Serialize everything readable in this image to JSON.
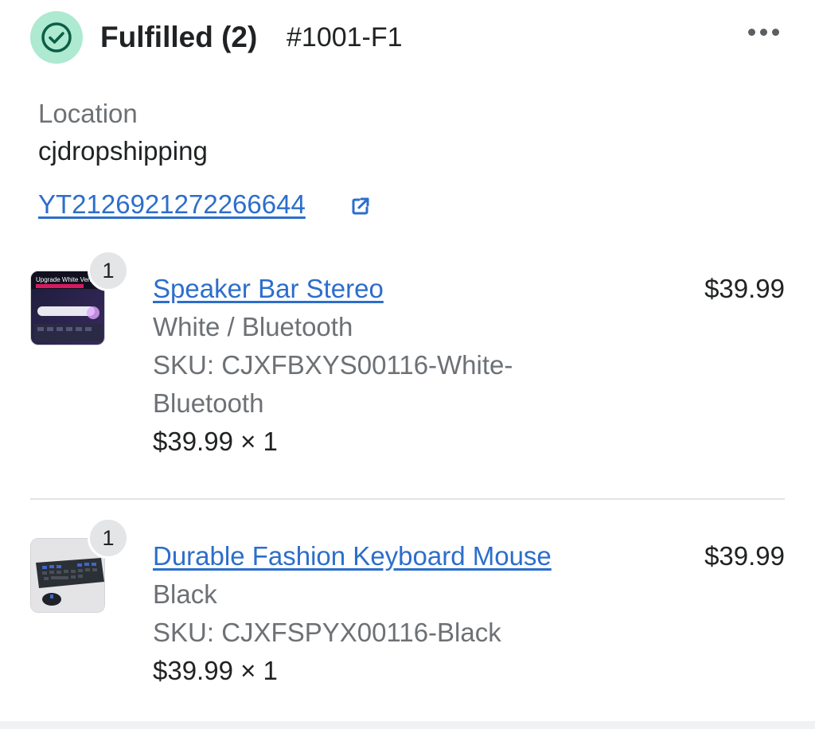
{
  "header": {
    "title": "Fulfilled (2)",
    "order_number": "#1001-F1",
    "status_icon": "check-circle-icon",
    "more_icon": "more-horizontal-icon",
    "status_color": "#aee9d1"
  },
  "location": {
    "label": "Location",
    "value": "cjdropshipping"
  },
  "tracking": {
    "number": "YT2126921272266644",
    "icon": "external-link-icon"
  },
  "items": [
    {
      "quantity": "1",
      "name": "Speaker Bar Stereo",
      "variant": "White / Bluetooth",
      "sku_line1": "SKU: CJXFBXYS00116-White-",
      "sku_line2": "Bluetooth",
      "unit_price": "$39.99 × 1",
      "total": "$39.99"
    },
    {
      "quantity": "1",
      "name": "Durable Fashion Keyboard Mouse",
      "variant": "Black",
      "sku_line1": "SKU: CJXFSPYX00116-Black",
      "unit_price": "$39.99 × 1",
      "total": "$39.99"
    }
  ],
  "colors": {
    "link": "#2c6ecb",
    "success": "#aee9d1",
    "success_dark": "#007f5f"
  }
}
